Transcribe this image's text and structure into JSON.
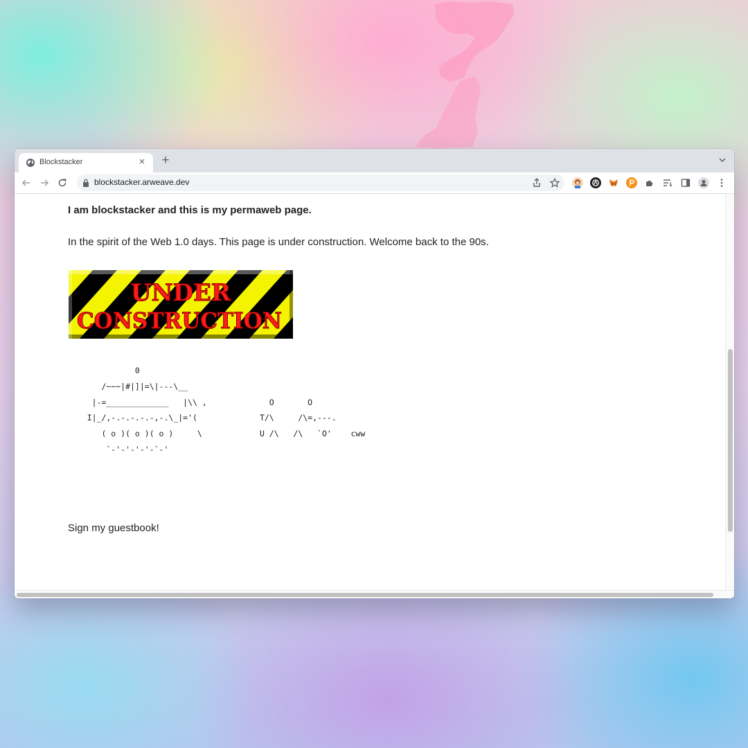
{
  "browser": {
    "tab_title": "Blockstacker",
    "tab_close": "×",
    "new_tab": "+",
    "url": "blockstacker.arweave.dev"
  },
  "page": {
    "intro": "I am blockstacker and this is my permaweb page.",
    "spirit": "In the spirit of the Web 1.0 days. This page is under construction. Welcome back to the 90s.",
    "banner": {
      "line1": "UNDER",
      "line2": "CONSTRUCTION",
      "colors": {
        "stripe_yellow": "#f4f400",
        "stripe_black": "#000000",
        "text_red": "#ff1a1a"
      }
    },
    "ascii_art": "              0\n       /~~~|#|]|=\\|---\\__\n     |-=_____________   |\\\\ ,             O       O\n    I|_/,-.-.-.-.-,-.\\_|='(             T/\\     /\\=,---.\n       ( o )( o )( o )     \\            U /\\   /\\   `O'    cww\n        `-'-'-'-'-`-'",
    "guestbook": "Sign my guestbook!"
  },
  "icons": {
    "tab_favicon": "globe-icon",
    "back": "arrow-left-icon",
    "forward": "arrow-right-icon",
    "reload": "reload-icon",
    "lock": "lock-icon",
    "share": "share-icon",
    "bookmark": "star-icon",
    "extensions": [
      "avatar-extension-icon",
      "arconnect-icon",
      "metamask-fox-icon",
      "orange-coin-icon",
      "puzzle-icon",
      "reading-list-icon",
      "side-panel-icon",
      "profile-icon",
      "kebab-menu-icon"
    ]
  }
}
